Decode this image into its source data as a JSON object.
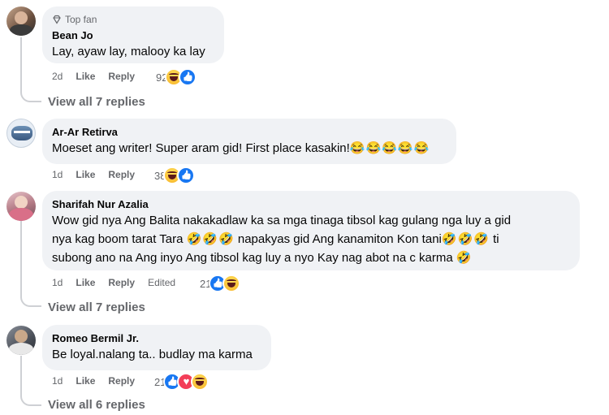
{
  "comments": [
    {
      "badge": "Top fan",
      "name": "Bean Jo",
      "text": "Lay, ayaw lay, malooy ka lay",
      "time": "2d",
      "like": "Like",
      "reply": "Reply",
      "reaction_count": "92",
      "reactions": [
        "haha",
        "like"
      ],
      "view_replies": "View all 7 replies"
    },
    {
      "name": "Ar-Ar Retirva",
      "text": "Moeset ang writer! Super aram gid! First place kasakin!",
      "text_emojis": "😂😂😂😂😂",
      "time": "1d",
      "like": "Like",
      "reply": "Reply",
      "reaction_count": "38",
      "reactions": [
        "haha",
        "like"
      ]
    },
    {
      "name": "Sharifah Nur Azalia",
      "line1": "Wow gid nya Ang Balita nakakadlaw ka sa mga tinaga tibsol kag gulang nga luy a gid",
      "line2a": "nya kag boom tarat Tara ",
      "line2_emojis_a": "🤣🤣🤣",
      "line2b": " napakyas gid Ang kanamiton Kon tani",
      "line2_emojis_b": "🤣🤣🤣",
      "line2c": " ti",
      "line3": "subong ano na Ang inyo Ang tibsol kag luy a nyo Kay nag abot na c karma ",
      "line3_emoji": "🤣",
      "time": "1d",
      "like": "Like",
      "reply": "Reply",
      "edited": "Edited",
      "reaction_count": "21",
      "reactions": [
        "like",
        "haha"
      ],
      "view_replies": "View all 7 replies"
    },
    {
      "name": "Romeo Bermil Jr.",
      "text": "Be loyal.nalang ta.. budlay ma karma",
      "time": "1d",
      "like": "Like",
      "reply": "Reply",
      "reaction_count": "21",
      "reactions": [
        "like",
        "love",
        "haha"
      ],
      "view_replies": "View all 6 replies"
    }
  ],
  "colors": {
    "bubble": "#f0f2f5",
    "secondary_text": "#65676b",
    "like_blue": "#1877f2",
    "love_red": "#f33e58",
    "haha_yellow": "#f7b125",
    "thread_line": "#ced0d4"
  },
  "icons": {
    "top_fan": "diamond-icon"
  }
}
